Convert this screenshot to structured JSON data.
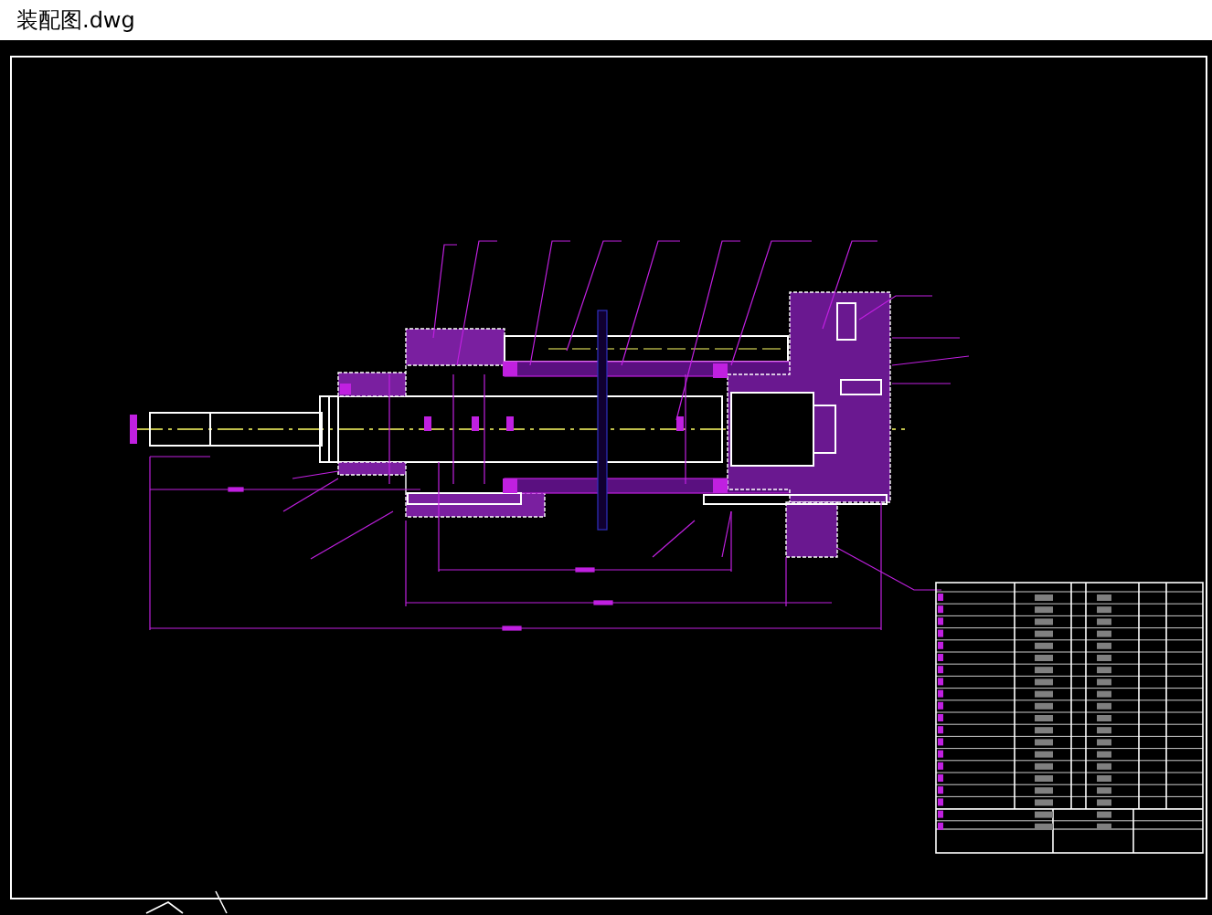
{
  "window": {
    "title": "装配图.dwg"
  }
}
